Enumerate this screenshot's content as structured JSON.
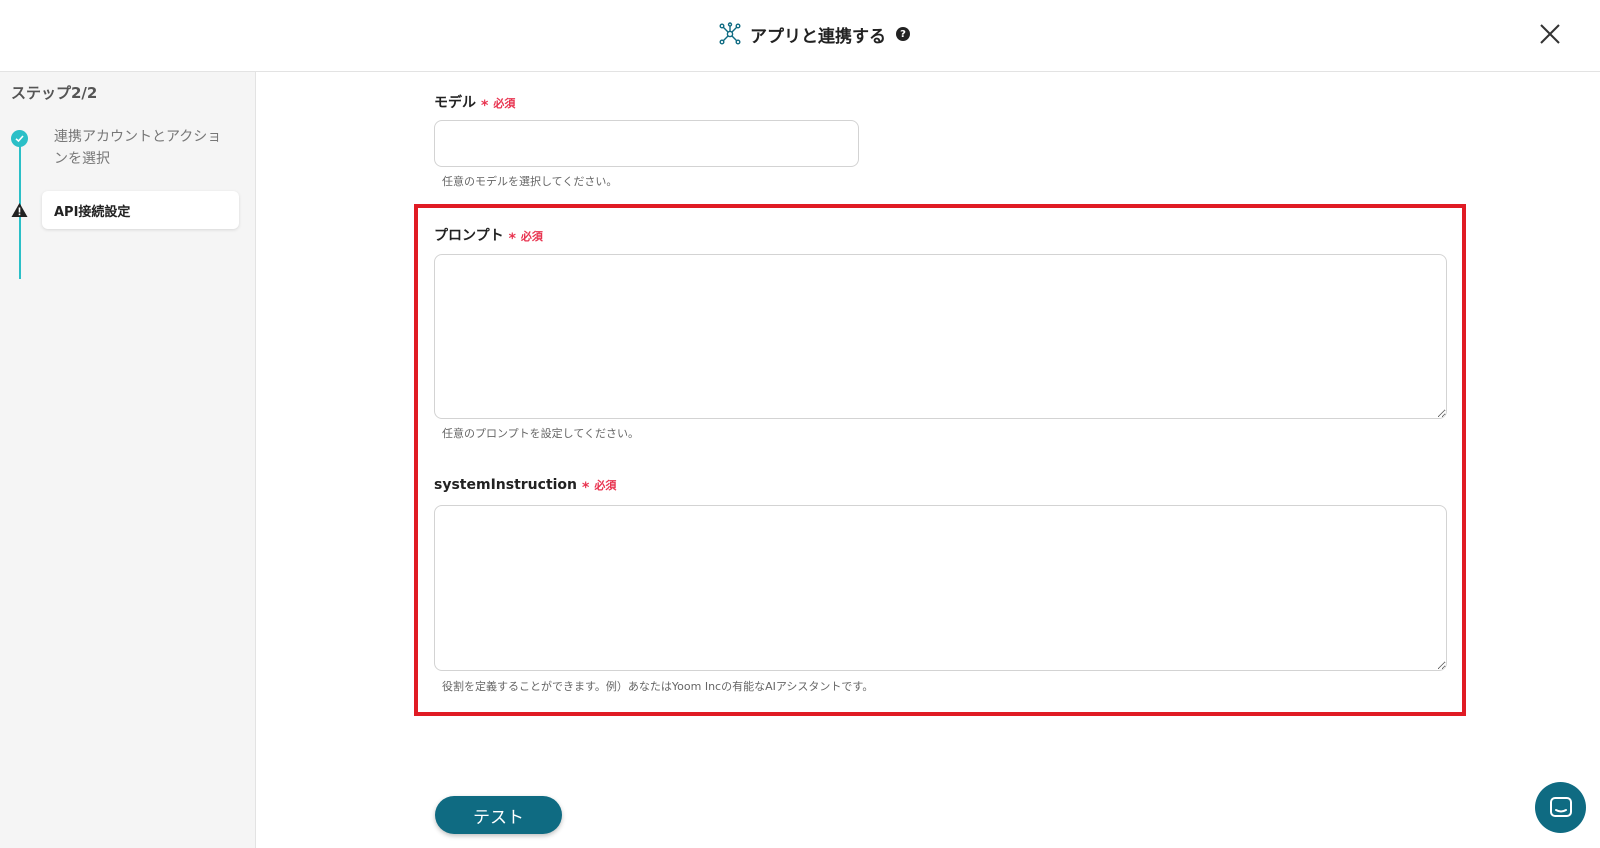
{
  "header": {
    "title": "アプリと連携する",
    "help_icon_text": "?"
  },
  "sidebar": {
    "step_count": "ステップ2/2",
    "steps": [
      {
        "label": "連携アカウントとアクションを選択",
        "status": "done"
      },
      {
        "label": "API接続設定",
        "status": "warning"
      }
    ]
  },
  "form": {
    "model": {
      "label": "モデル",
      "required_mark": "*",
      "required_text": "必須",
      "value": "",
      "hint": "任意のモデルを選択してください。"
    },
    "prompt": {
      "label": "プロンプト",
      "required_mark": "*",
      "required_text": "必須",
      "value": "",
      "hint": "任意のプロンプトを設定してください。"
    },
    "system_instruction": {
      "label": "systemInstruction",
      "required_mark": "*",
      "required_text": "必須",
      "value": "",
      "hint": "役割を定義することができます。例）あなたはYoom Incの有能なAIアシスタントです。"
    }
  },
  "actions": {
    "test_label": "テスト"
  },
  "colors": {
    "accent": "#0f6b82",
    "step_teal": "#2bbfc7",
    "required_red": "#e8334f",
    "highlight_red": "#e01b24"
  },
  "icons": {
    "header_icon": "app-network-icon",
    "close": "close-icon",
    "chat": "chat-icon"
  }
}
